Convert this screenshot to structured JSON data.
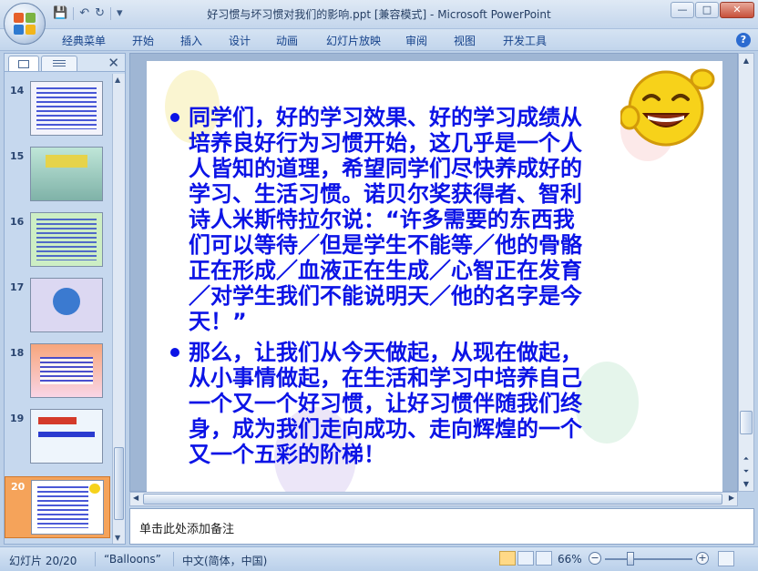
{
  "window": {
    "title": "好习惯与坏习惯对我们的影响.ppt [兼容模式] - Microsoft PowerPoint",
    "controls": {
      "minimize": "—",
      "maximize": "□",
      "close": "✕"
    }
  },
  "qat": {
    "save": "💾",
    "undo": "↶",
    "redo": "↻",
    "more": "▾"
  },
  "ribbon": {
    "tabs": [
      "经典菜单",
      "开始",
      "插入",
      "设计",
      "动画",
      "幻灯片放映",
      "审阅",
      "视图",
      "开发工具"
    ],
    "help": "?"
  },
  "left_panel": {
    "close": "✕",
    "slides": [
      {
        "num": "14"
      },
      {
        "num": "15"
      },
      {
        "num": "16"
      },
      {
        "num": "17"
      },
      {
        "num": "18"
      },
      {
        "num": "19"
      },
      {
        "num": "20"
      }
    ]
  },
  "slide": {
    "bullets": [
      "同学们，好的学习效果、好的学习成绩从\n培养良好行为习惯开始，这几乎是一个人\n人皆知的道理，希望同学们尽快养成好的\n学习、生活习惯。诺贝尔奖获得者、智利\n诗人米斯特拉尔说：“许多需要的东西我\n们可以等待／但是学生不能等／他的骨骼\n正在形成／血液正在生成／心智正在发育\n／对学生我们不能说明天／他的名字是今\n天！”",
      "那么，让我们从今天做起，从现在做起，\n从小事情做起，在生活和学习中培养自己\n一个又一个好习惯，让好习惯伴随我们终\n身，成为我们走向成功、走向辉煌的一个\n又一个五彩的阶梯！"
    ],
    "text_color": "#0b13e6"
  },
  "notes": {
    "placeholder": "单击此处添加备注"
  },
  "status": {
    "slide_info": "幻灯片 20/20",
    "theme": "“Balloons”",
    "language": "中文(简体，中国)",
    "zoom": "66%",
    "zoom_minus": "−",
    "zoom_plus": "+"
  }
}
